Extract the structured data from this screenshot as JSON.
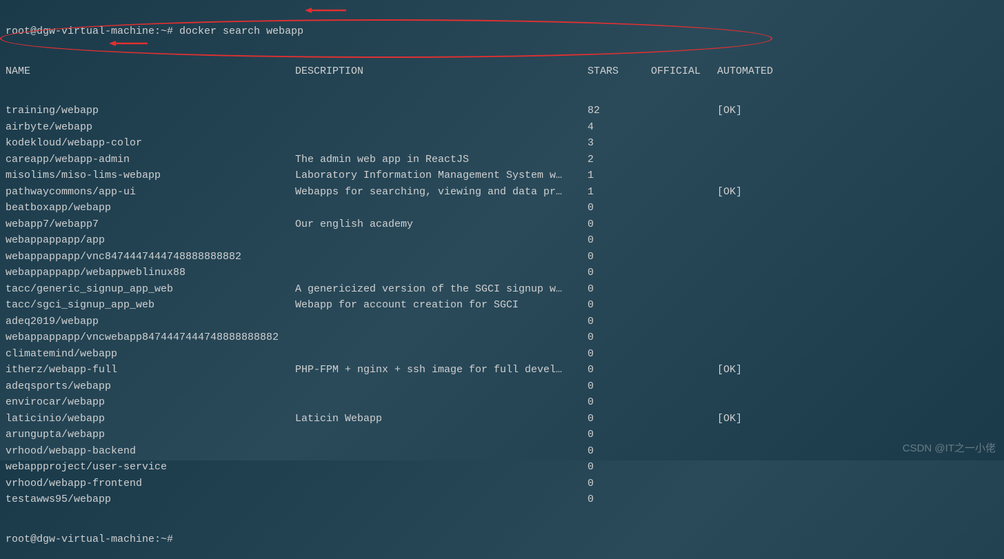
{
  "prompt1": "root@dgw-virtual-machine:~# ",
  "command": "docker search webapp",
  "prompt2": "root@dgw-virtual-machine:~# ",
  "headers": {
    "name": "NAME",
    "description": "DESCRIPTION",
    "stars": "STARS",
    "official": "OFFICIAL",
    "automated": "AUTOMATED"
  },
  "rows": [
    {
      "name": "training/webapp",
      "desc": "",
      "stars": "82",
      "official": "",
      "automated": "[OK]"
    },
    {
      "name": "airbyte/webapp",
      "desc": "",
      "stars": "4",
      "official": "",
      "automated": ""
    },
    {
      "name": "kodekloud/webapp-color",
      "desc": "",
      "stars": "3",
      "official": "",
      "automated": ""
    },
    {
      "name": "careapp/webapp-admin",
      "desc": "The admin web app in ReactJS",
      "stars": "2",
      "official": "",
      "automated": ""
    },
    {
      "name": "misolims/miso-lims-webapp",
      "desc": "Laboratory Information Management System w…",
      "stars": "1",
      "official": "",
      "automated": ""
    },
    {
      "name": "pathwaycommons/app-ui",
      "desc": "Webapps for searching, viewing and data pr…",
      "stars": "1",
      "official": "",
      "automated": "[OK]"
    },
    {
      "name": "beatboxapp/webapp",
      "desc": "",
      "stars": "0",
      "official": "",
      "automated": ""
    },
    {
      "name": "webapp7/webapp7",
      "desc": "Our english academy",
      "stars": "0",
      "official": "",
      "automated": ""
    },
    {
      "name": "webappappapp/app",
      "desc": "",
      "stars": "0",
      "official": "",
      "automated": ""
    },
    {
      "name": "webappappapp/vnc8474447444748888888882",
      "desc": "",
      "stars": "0",
      "official": "",
      "automated": ""
    },
    {
      "name": "webappappapp/webappweblinux88",
      "desc": "",
      "stars": "0",
      "official": "",
      "automated": ""
    },
    {
      "name": "tacc/generic_signup_app_web",
      "desc": "A genericized version of the SGCI signup w…",
      "stars": "0",
      "official": "",
      "automated": ""
    },
    {
      "name": "tacc/sgci_signup_app_web",
      "desc": "Webapp for account creation for SGCI",
      "stars": "0",
      "official": "",
      "automated": ""
    },
    {
      "name": "adeq2019/webapp",
      "desc": "",
      "stars": "0",
      "official": "",
      "automated": ""
    },
    {
      "name": "webappappapp/vncwebapp8474447444748888888882",
      "desc": "",
      "stars": "0",
      "official": "",
      "automated": ""
    },
    {
      "name": "climatemind/webapp",
      "desc": "",
      "stars": "0",
      "official": "",
      "automated": ""
    },
    {
      "name": "itherz/webapp-full",
      "desc": "PHP-FPM + nginx + ssh image for full devel…",
      "stars": "0",
      "official": "",
      "automated": "[OK]"
    },
    {
      "name": "adeqsports/webapp",
      "desc": "",
      "stars": "0",
      "official": "",
      "automated": ""
    },
    {
      "name": "envirocar/webapp",
      "desc": "",
      "stars": "0",
      "official": "",
      "automated": ""
    },
    {
      "name": "laticinio/webapp",
      "desc": "Laticin Webapp",
      "stars": "0",
      "official": "",
      "automated": "[OK]"
    },
    {
      "name": "arungupta/webapp",
      "desc": "",
      "stars": "0",
      "official": "",
      "automated": ""
    },
    {
      "name": "vrhood/webapp-backend",
      "desc": "",
      "stars": "0",
      "official": "",
      "automated": ""
    },
    {
      "name": "webappproject/user-service",
      "desc": "",
      "stars": "0",
      "official": "",
      "automated": ""
    },
    {
      "name": "vrhood/webapp-frontend",
      "desc": "",
      "stars": "0",
      "official": "",
      "automated": ""
    },
    {
      "name": "testawws95/webapp",
      "desc": "",
      "stars": "0",
      "official": "",
      "automated": ""
    }
  ],
  "watermark": "CSDN @IT之一小佬"
}
